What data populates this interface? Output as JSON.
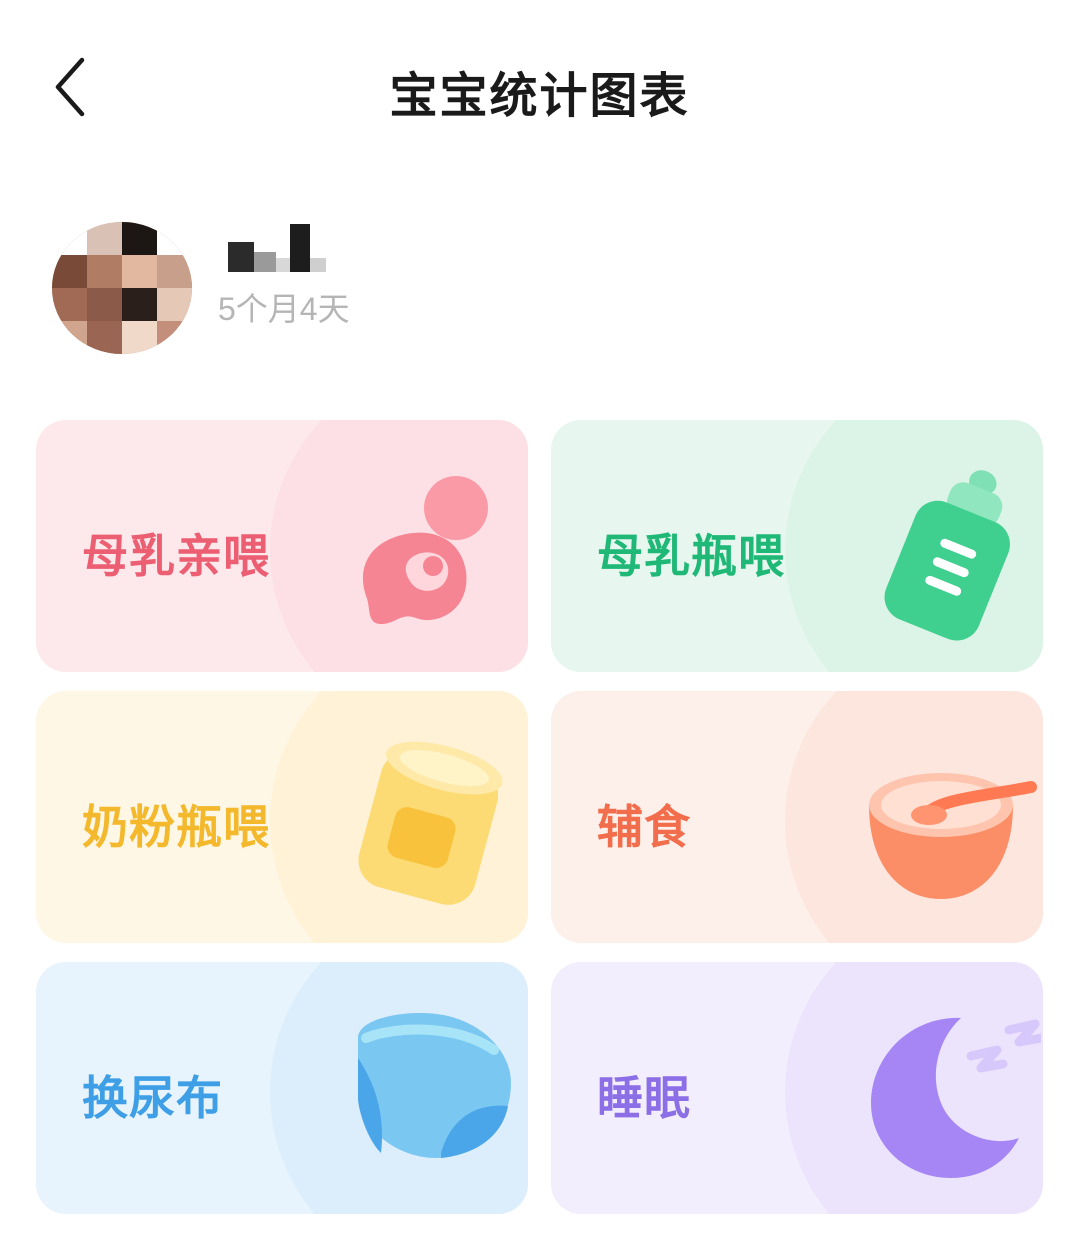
{
  "header": {
    "title": "宝宝统计图表",
    "back_icon": "chevron-left-icon"
  },
  "profile": {
    "age": "5个月4天"
  },
  "cards": [
    {
      "label": "母乳亲喂",
      "icon": "breastfeeding-icon",
      "color": "#ec5f73"
    },
    {
      "label": "母乳瓶喂",
      "icon": "baby-bottle-icon",
      "color": "#1fb877"
    },
    {
      "label": "奶粉瓶喂",
      "icon": "formula-can-icon",
      "color": "#f3b82c"
    },
    {
      "label": "辅食",
      "icon": "food-bowl-icon",
      "color": "#f26d4b"
    },
    {
      "label": "换尿布",
      "icon": "diaper-icon",
      "color": "#3e9fe6"
    },
    {
      "label": "睡眠",
      "icon": "moon-sleep-icon",
      "color": "#8c6ee6"
    }
  ]
}
